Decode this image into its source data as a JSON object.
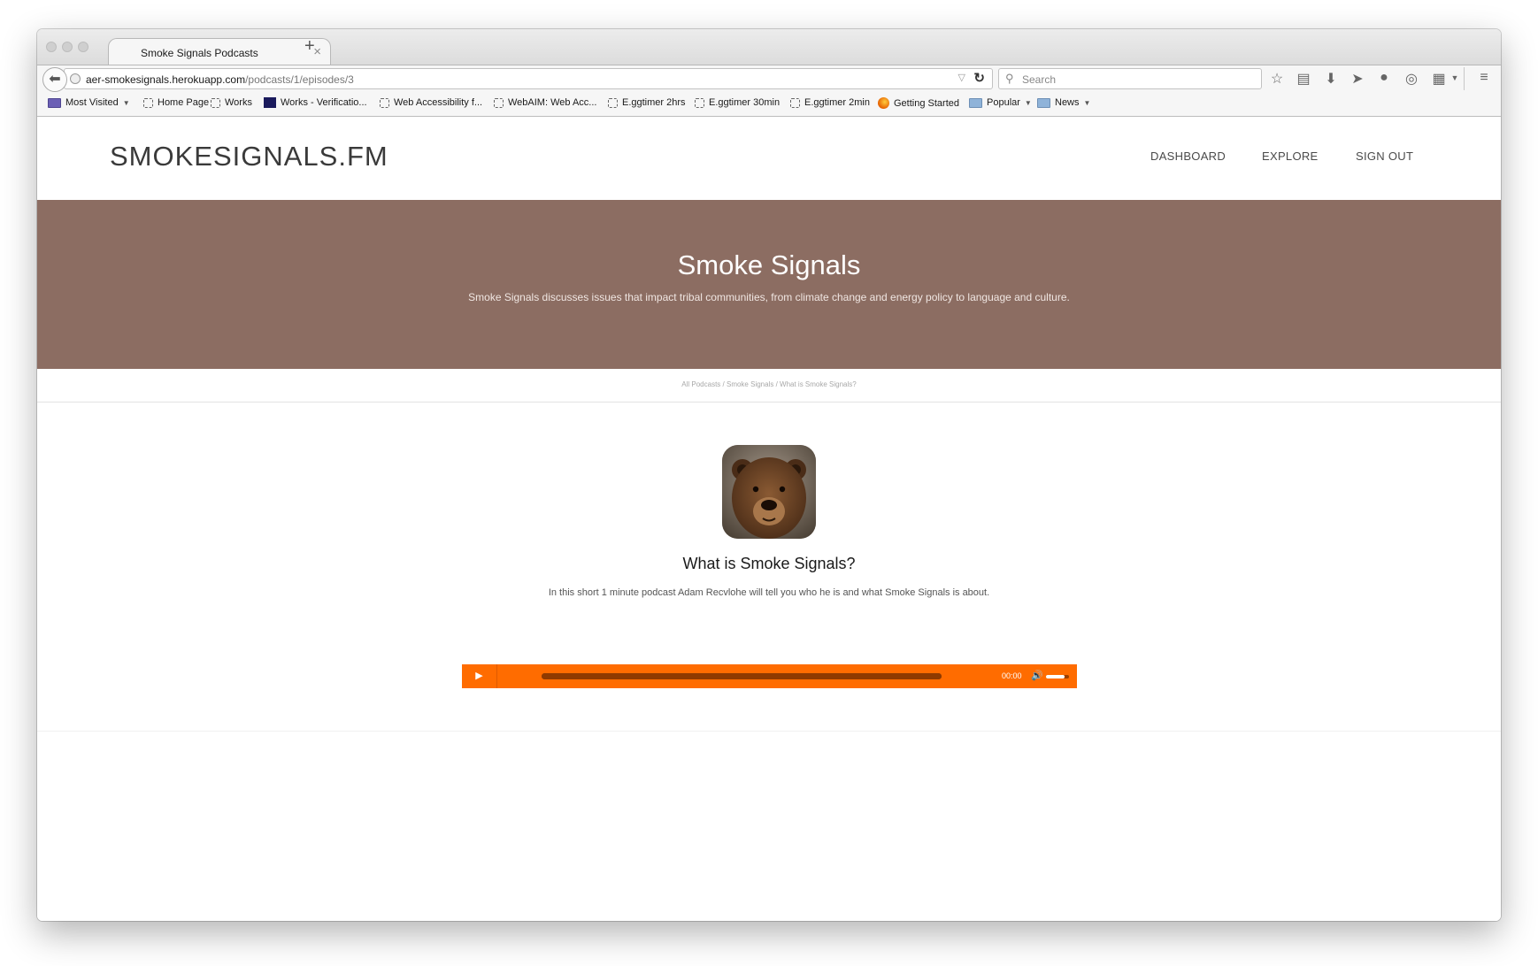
{
  "browser": {
    "tab_title": "Smoke Signals Podcasts",
    "tab_close": "×",
    "new_tab": "+",
    "url_host": "aer-smokesignals.herokuapp.com",
    "url_path": "/podcasts/1/episodes/3",
    "search_placeholder": "Search",
    "bookmarks": [
      {
        "label": "Most Visited",
        "kind": "folder-mv",
        "caret": true
      },
      {
        "label": "Home Page",
        "kind": "page"
      },
      {
        "label": "Works",
        "kind": "page"
      },
      {
        "label": "Works - Verificatio...",
        "kind": "works"
      },
      {
        "label": "Web Accessibility f...",
        "kind": "page"
      },
      {
        "label": "WebAIM: Web Acc...",
        "kind": "page"
      },
      {
        "label": "E.ggtimer 2hrs",
        "kind": "page"
      },
      {
        "label": "E.ggtimer 30min",
        "kind": "page"
      },
      {
        "label": "E.ggtimer 2min",
        "kind": "page"
      },
      {
        "label": "Getting Started",
        "kind": "firefox"
      },
      {
        "label": "Popular",
        "kind": "folder",
        "caret": true
      },
      {
        "label": "News",
        "kind": "folder",
        "caret": true
      }
    ]
  },
  "site": {
    "logo": "SMOKESIGNALS.FM",
    "nav": {
      "dashboard": "DASHBOARD",
      "explore": "EXPLORE",
      "sign_out": "SIGN OUT"
    },
    "hero": {
      "title": "Smoke Signals",
      "description": "Smoke Signals discusses issues that impact tribal communities, from climate change and energy policy to language and culture.",
      "background_color": "#8c6d62"
    },
    "breadcrumb": {
      "all_podcasts": "All Podcasts",
      "podcast": "Smoke Signals",
      "episode": "What is Smoke Signals?",
      "separator": " / "
    },
    "episode": {
      "title": "What is Smoke Signals?",
      "description": "In this short 1 minute podcast Adam Recvlohe will tell you who he is and what Smoke Signals is about."
    },
    "player": {
      "time": "00:00",
      "accent_color": "#ff6c00",
      "progress_fraction": 1.0,
      "volume_fraction": 0.8
    }
  }
}
